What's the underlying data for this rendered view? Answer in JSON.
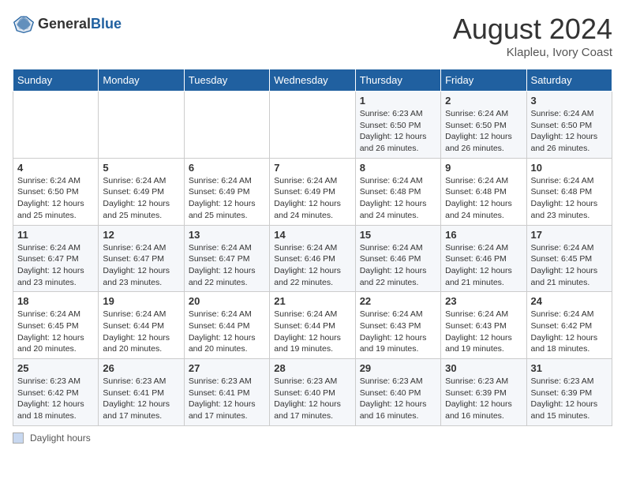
{
  "header": {
    "logo_general": "General",
    "logo_blue": "Blue",
    "month_title": "August 2024",
    "location": "Klapleu, Ivory Coast"
  },
  "days_of_week": [
    "Sunday",
    "Monday",
    "Tuesday",
    "Wednesday",
    "Thursday",
    "Friday",
    "Saturday"
  ],
  "legend_label": "Daylight hours",
  "weeks": [
    [
      {
        "day": "",
        "info": ""
      },
      {
        "day": "",
        "info": ""
      },
      {
        "day": "",
        "info": ""
      },
      {
        "day": "",
        "info": ""
      },
      {
        "day": "1",
        "info": "Sunrise: 6:23 AM\nSunset: 6:50 PM\nDaylight: 12 hours and 26 minutes."
      },
      {
        "day": "2",
        "info": "Sunrise: 6:24 AM\nSunset: 6:50 PM\nDaylight: 12 hours and 26 minutes."
      },
      {
        "day": "3",
        "info": "Sunrise: 6:24 AM\nSunset: 6:50 PM\nDaylight: 12 hours and 26 minutes."
      }
    ],
    [
      {
        "day": "4",
        "info": "Sunrise: 6:24 AM\nSunset: 6:50 PM\nDaylight: 12 hours and 25 minutes."
      },
      {
        "day": "5",
        "info": "Sunrise: 6:24 AM\nSunset: 6:49 PM\nDaylight: 12 hours and 25 minutes."
      },
      {
        "day": "6",
        "info": "Sunrise: 6:24 AM\nSunset: 6:49 PM\nDaylight: 12 hours and 25 minutes."
      },
      {
        "day": "7",
        "info": "Sunrise: 6:24 AM\nSunset: 6:49 PM\nDaylight: 12 hours and 24 minutes."
      },
      {
        "day": "8",
        "info": "Sunrise: 6:24 AM\nSunset: 6:48 PM\nDaylight: 12 hours and 24 minutes."
      },
      {
        "day": "9",
        "info": "Sunrise: 6:24 AM\nSunset: 6:48 PM\nDaylight: 12 hours and 24 minutes."
      },
      {
        "day": "10",
        "info": "Sunrise: 6:24 AM\nSunset: 6:48 PM\nDaylight: 12 hours and 23 minutes."
      }
    ],
    [
      {
        "day": "11",
        "info": "Sunrise: 6:24 AM\nSunset: 6:47 PM\nDaylight: 12 hours and 23 minutes."
      },
      {
        "day": "12",
        "info": "Sunrise: 6:24 AM\nSunset: 6:47 PM\nDaylight: 12 hours and 23 minutes."
      },
      {
        "day": "13",
        "info": "Sunrise: 6:24 AM\nSunset: 6:47 PM\nDaylight: 12 hours and 22 minutes."
      },
      {
        "day": "14",
        "info": "Sunrise: 6:24 AM\nSunset: 6:46 PM\nDaylight: 12 hours and 22 minutes."
      },
      {
        "day": "15",
        "info": "Sunrise: 6:24 AM\nSunset: 6:46 PM\nDaylight: 12 hours and 22 minutes."
      },
      {
        "day": "16",
        "info": "Sunrise: 6:24 AM\nSunset: 6:46 PM\nDaylight: 12 hours and 21 minutes."
      },
      {
        "day": "17",
        "info": "Sunrise: 6:24 AM\nSunset: 6:45 PM\nDaylight: 12 hours and 21 minutes."
      }
    ],
    [
      {
        "day": "18",
        "info": "Sunrise: 6:24 AM\nSunset: 6:45 PM\nDaylight: 12 hours and 20 minutes."
      },
      {
        "day": "19",
        "info": "Sunrise: 6:24 AM\nSunset: 6:44 PM\nDaylight: 12 hours and 20 minutes."
      },
      {
        "day": "20",
        "info": "Sunrise: 6:24 AM\nSunset: 6:44 PM\nDaylight: 12 hours and 20 minutes."
      },
      {
        "day": "21",
        "info": "Sunrise: 6:24 AM\nSunset: 6:44 PM\nDaylight: 12 hours and 19 minutes."
      },
      {
        "day": "22",
        "info": "Sunrise: 6:24 AM\nSunset: 6:43 PM\nDaylight: 12 hours and 19 minutes."
      },
      {
        "day": "23",
        "info": "Sunrise: 6:24 AM\nSunset: 6:43 PM\nDaylight: 12 hours and 19 minutes."
      },
      {
        "day": "24",
        "info": "Sunrise: 6:24 AM\nSunset: 6:42 PM\nDaylight: 12 hours and 18 minutes."
      }
    ],
    [
      {
        "day": "25",
        "info": "Sunrise: 6:23 AM\nSunset: 6:42 PM\nDaylight: 12 hours and 18 minutes."
      },
      {
        "day": "26",
        "info": "Sunrise: 6:23 AM\nSunset: 6:41 PM\nDaylight: 12 hours and 17 minutes."
      },
      {
        "day": "27",
        "info": "Sunrise: 6:23 AM\nSunset: 6:41 PM\nDaylight: 12 hours and 17 minutes."
      },
      {
        "day": "28",
        "info": "Sunrise: 6:23 AM\nSunset: 6:40 PM\nDaylight: 12 hours and 17 minutes."
      },
      {
        "day": "29",
        "info": "Sunrise: 6:23 AM\nSunset: 6:40 PM\nDaylight: 12 hours and 16 minutes."
      },
      {
        "day": "30",
        "info": "Sunrise: 6:23 AM\nSunset: 6:39 PM\nDaylight: 12 hours and 16 minutes."
      },
      {
        "day": "31",
        "info": "Sunrise: 6:23 AM\nSunset: 6:39 PM\nDaylight: 12 hours and 15 minutes."
      }
    ]
  ]
}
